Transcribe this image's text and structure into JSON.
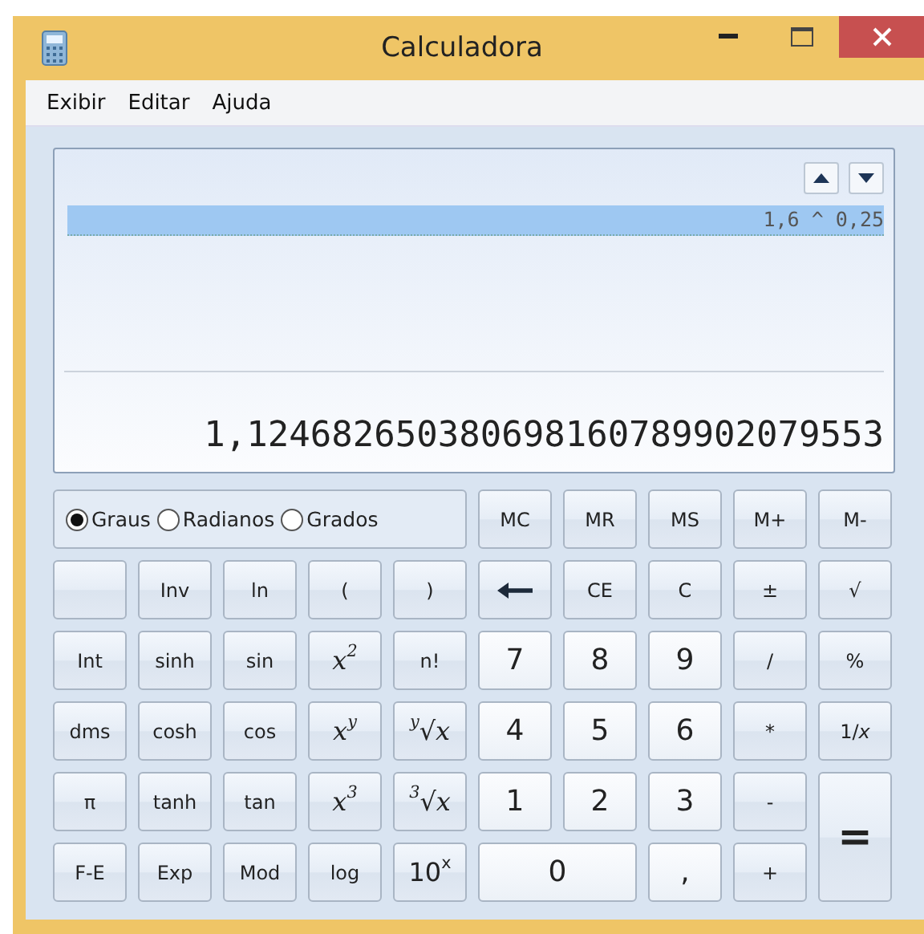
{
  "window": {
    "title": "Calculadora"
  },
  "menu": [
    "Exibir",
    "Editar",
    "Ajuda"
  ],
  "display": {
    "history": [
      {
        "expression": "1,6 ^ 0,25",
        "selected": true
      }
    ],
    "result": "1,124682650380698160789902079553"
  },
  "angle_units": [
    {
      "label": "Graus",
      "selected": true
    },
    {
      "label": "Radianos",
      "selected": false
    },
    {
      "label": "Grados",
      "selected": false
    }
  ],
  "scientific_keys": [
    {
      "kind": "blank"
    },
    {
      "kind": "text",
      "label": "Inv"
    },
    {
      "kind": "text",
      "label": "ln"
    },
    {
      "kind": "text",
      "label": "("
    },
    {
      "kind": "text",
      "label": ")"
    },
    {
      "kind": "text",
      "label": "Int"
    },
    {
      "kind": "text",
      "label": "sinh"
    },
    {
      "kind": "text",
      "label": "sin"
    },
    {
      "kind": "math",
      "label": "x$^{2}$"
    },
    {
      "kind": "text",
      "label": "n!"
    },
    {
      "kind": "text",
      "label": "dms"
    },
    {
      "kind": "text",
      "label": "cosh"
    },
    {
      "kind": "text",
      "label": "cos"
    },
    {
      "kind": "math",
      "label": "x$^{y}$"
    },
    {
      "kind": "math",
      "label": "$^{y}$√x"
    },
    {
      "kind": "text",
      "label": "π"
    },
    {
      "kind": "text",
      "label": "tanh"
    },
    {
      "kind": "text",
      "label": "tan"
    },
    {
      "kind": "math",
      "label": "x$^{3}$"
    },
    {
      "kind": "math",
      "label": "$^{3}$√x"
    },
    {
      "kind": "text",
      "label": "F-E"
    },
    {
      "kind": "text",
      "label": "Exp"
    },
    {
      "kind": "text",
      "label": "Mod"
    },
    {
      "kind": "text",
      "label": "log"
    },
    {
      "kind": "big",
      "label": "10$^{x}$"
    }
  ],
  "standard_keys": [
    {
      "kind": "text",
      "label": "MC"
    },
    {
      "kind": "text",
      "label": "MR"
    },
    {
      "kind": "text",
      "label": "MS"
    },
    {
      "kind": "text",
      "label": "M+"
    },
    {
      "kind": "text",
      "label": "M-"
    },
    {
      "kind": "backspace"
    },
    {
      "kind": "text",
      "label": "CE"
    },
    {
      "kind": "text",
      "label": "C"
    },
    {
      "kind": "text",
      "label": "±"
    },
    {
      "kind": "text",
      "label": "√"
    },
    {
      "kind": "digit",
      "label": "7"
    },
    {
      "kind": "digit",
      "label": "8"
    },
    {
      "kind": "digit",
      "label": "9"
    },
    {
      "kind": "text",
      "label": "/"
    },
    {
      "kind": "text",
      "label": "%"
    },
    {
      "kind": "digit",
      "label": "4"
    },
    {
      "kind": "digit",
      "label": "5"
    },
    {
      "kind": "digit",
      "label": "6"
    },
    {
      "kind": "text",
      "label": "*"
    },
    {
      "kind": "text",
      "label": "1/*x*"
    },
    {
      "kind": "digit",
      "label": "1"
    },
    {
      "kind": "digit",
      "label": "2"
    },
    {
      "kind": "digit",
      "label": "3"
    },
    {
      "kind": "text",
      "label": "-"
    },
    {
      "kind": "equals",
      "label": "=",
      "spans_two_rows": true
    },
    {
      "kind": "digit",
      "label": "0",
      "spans_two_columns": true
    },
    {
      "kind": "digit",
      "label": ","
    },
    {
      "kind": "text",
      "label": "+"
    }
  ]
}
